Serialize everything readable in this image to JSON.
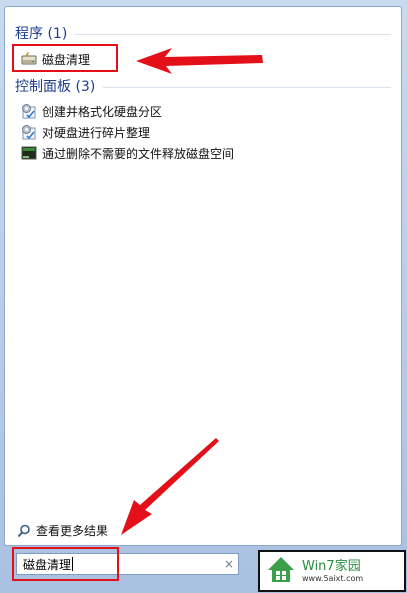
{
  "groups": [
    {
      "title": "程序 (1)",
      "items": [
        {
          "label": "磁盘清理",
          "icon": "disk-cleanup-icon"
        }
      ]
    },
    {
      "title": "控制面板 (3)",
      "items": [
        {
          "label": "创建并格式化硬盘分区",
          "icon": "control-panel-settings-icon"
        },
        {
          "label": "对硬盘进行碎片整理",
          "icon": "control-panel-settings-icon"
        },
        {
          "label": "通过删除不需要的文件释放磁盘空间",
          "icon": "disk-space-icon"
        }
      ]
    }
  ],
  "more_results": {
    "label": "查看更多结果",
    "icon": "search-icon"
  },
  "search": {
    "value": "磁盘清理",
    "clear": "×"
  },
  "watermark": {
    "title": "Win7家园",
    "url": "www.5aixt.com"
  },
  "annotation_color": "#e3101a"
}
